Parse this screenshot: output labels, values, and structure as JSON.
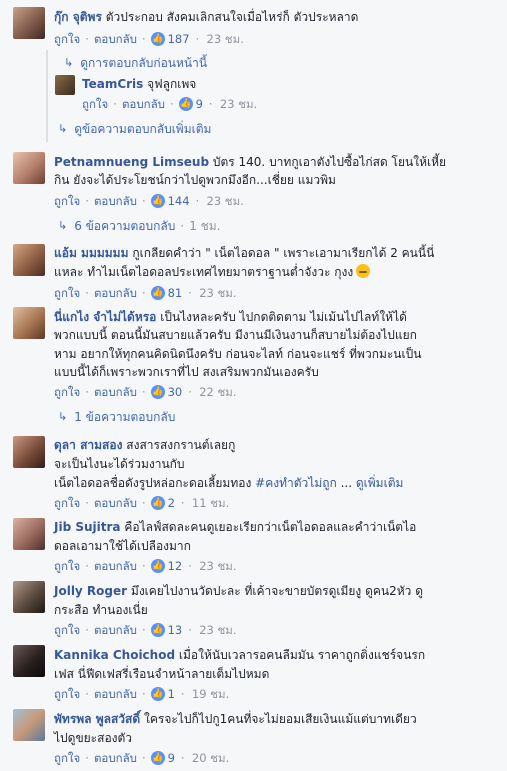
{
  "ui": {
    "like": "ถูกใจ",
    "reply": "ตอบกลับ",
    "sep": "·",
    "like_icon": "thumbs-up-icon",
    "reply_arrow": "↳",
    "like_color": "#5890ff",
    "link_color": "#4267b2",
    "name_color": "#365899"
  },
  "comments": [
    {
      "name": "กุ๊ก จุติพร",
      "lines": [
        "ตัวประกอบ สังคมเลิกสนใจเมื่อไหร่ก็ ตัวประหลาด"
      ],
      "likes": "187",
      "time": "23 ชม.",
      "previous_replies": "ดูการตอบกลับก่อนหน้านี้",
      "reply": {
        "name": "TeamCris",
        "text": "จุฟลูกเพจ",
        "likes": "9",
        "time": "23 ชม."
      },
      "more_replies": "ดูข้อความตอบกลับเพิ่มเติม"
    },
    {
      "name": "Petnamnueng Limseub",
      "lines": [
        "บัตร 140. บาทกูเอาตังไปซื้อไก่สด โยนให้เหี้ย",
        "กิน ยังจะได้ประโยชน์กว่าไปดูพวกมึงอีก...เชี่ยย แมวพิม"
      ],
      "likes": "144",
      "time": "23 ชม.",
      "replies_text": "6 ข้อความตอบกลับ",
      "replies_time": "1 ชม."
    },
    {
      "name": "แอ้ม มมมมมม",
      "lines": [
        "กูเกลียดคำว่า \" เน็ตไอดอล \" เพราะเอามาเรียกได้ 2 คนนี้นี่",
        "แหละ ทำไมเน็ตไอดอลประเทศไทยมาตราฐานต่ำจังวะ กุงง"
      ],
      "likes": "81",
      "time": "23 ชม."
    },
    {
      "name": "นี่แกไง จำไม่ได้หรอ",
      "lines": [
        "เป็นไงหละครับ ไปกดติดตาม ไม่เม้นไปไลท์ให้ได้",
        "พวกแบบนี้ ตอนนี้มันสบายแล้วครับ มีงานมีเงินงานก็สบายไม่ต้องไปแยก",
        "หาม อยากให้ทุกคนคิดนิดนึงครับ ก่อนจะไลท์ ก่อนจะแชร์ ที่พวกมะนเป็น",
        "แบบนี้ได้ก็เพราะพวกเราที่ไป สงเสริมพวกมันเองครับ"
      ],
      "likes": "30",
      "time": "22 ชม.",
      "replies_text": "1 ข้อความตอบกลับ"
    },
    {
      "name": "ดุลา สามสอง",
      "lines": [
        "สงสารสงกรานต์เลยกู",
        "จะเป็นไงนะได้ร่วมงานกับ",
        "เน็ตไอดอลชื่อดังรูปหล่อกะดอเลี้ยมทอง"
      ],
      "hashtag": "#คงทำตัวไม่ถูก",
      "ellipsis": "...",
      "see_more": "ดูเพิ่มเติม",
      "likes": "2",
      "time": "11 ชม."
    },
    {
      "name": "Jib Sujitra",
      "lines": [
        "คือไลฟ์สดละคนดูเยอะเรียกว่าเน็ตไอดอลและคำว่าเน็ตไอ",
        "ดอลเอามาใช้ได้เปลืองมาก"
      ],
      "likes": "12",
      "time": "23 ชม."
    },
    {
      "name": "Jolly Roger",
      "lines": [
        "มึงเคยไปงานวัดปะละ ที่เค้าจะขายบัตรดูเมียงู ดูคน2หัว ดู",
        "กระสือ ทำนองเนี่ย"
      ],
      "likes": "13",
      "time": "23 ชม."
    },
    {
      "name": "Kannika Choichod",
      "lines": [
        "เมื่อให้นับเวลารอคนลืมมัน ราคาถูกติ่งแชร์จนรก",
        "เฟส นี่ฟีดเฟสรี่เรือนจำหน้าลายเต็มไปหมด"
      ],
      "likes": "1",
      "time": "19 ชม."
    },
    {
      "name": "พัทรพล พูลสวัสดิ์",
      "lines": [
        "ใครจะไปก็ไปกู1คนที่จะไม่ยอมเสียเงินแม้แต่บาทเดียว",
        "ไปดูขยะสองตัว"
      ],
      "likes": "9",
      "time": "20 ชม."
    }
  ]
}
